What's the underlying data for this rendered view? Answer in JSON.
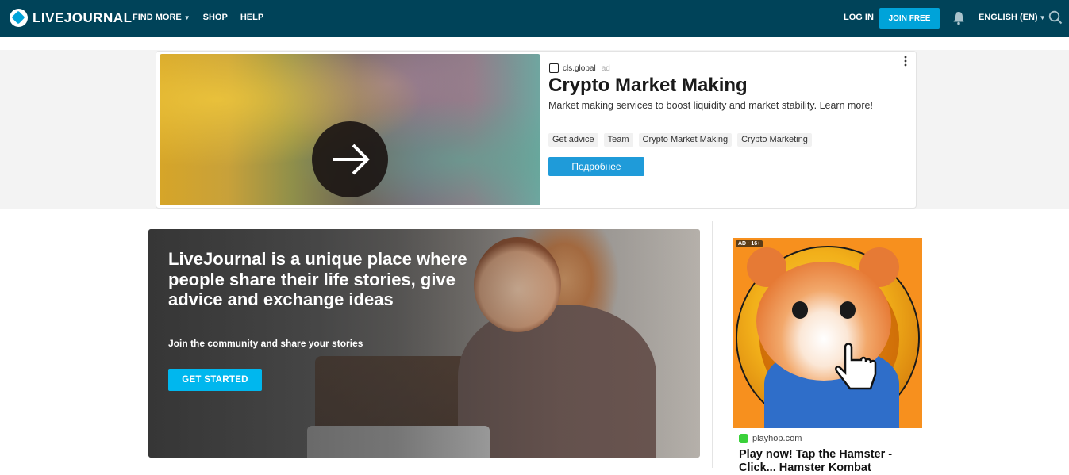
{
  "header": {
    "logo_text": "LIVEJOURNAL",
    "nav": [
      {
        "label": "FIND MORE",
        "has_caret": true
      },
      {
        "label": "SHOP",
        "has_caret": false
      },
      {
        "label": "HELP",
        "has_caret": false
      }
    ],
    "login_label": "LOG IN",
    "join_label": "JOIN FREE",
    "language_label": "ENGLISH (EN)",
    "icons": [
      "bell-icon",
      "search-icon"
    ]
  },
  "top_ad": {
    "source": "cls.global",
    "ad_label": "ad",
    "title": "Crypto Market Making",
    "description": "Market making services to boost liquidity and market stability. Learn more!",
    "tags": [
      "Get advice",
      "Team",
      "Crypto Market Making",
      "Crypto Marketing"
    ],
    "cta_label": "Подробнее"
  },
  "hero": {
    "title": "LiveJournal is a unique place where people share their life stories, give advice and exchange ideas",
    "subtitle": "Join the community and share your stories",
    "cta_label": "GET STARTED"
  },
  "side_ad": {
    "badge": "AD · 16+",
    "source": "playhop.com",
    "title": "Play now! Tap the Hamster - Click... Hamster Kombat"
  },
  "colors": {
    "header_bg": "#004359",
    "accent": "#00a3d9",
    "hero_cta": "#00b7ee",
    "ad_cta": "#1f9bd9"
  }
}
